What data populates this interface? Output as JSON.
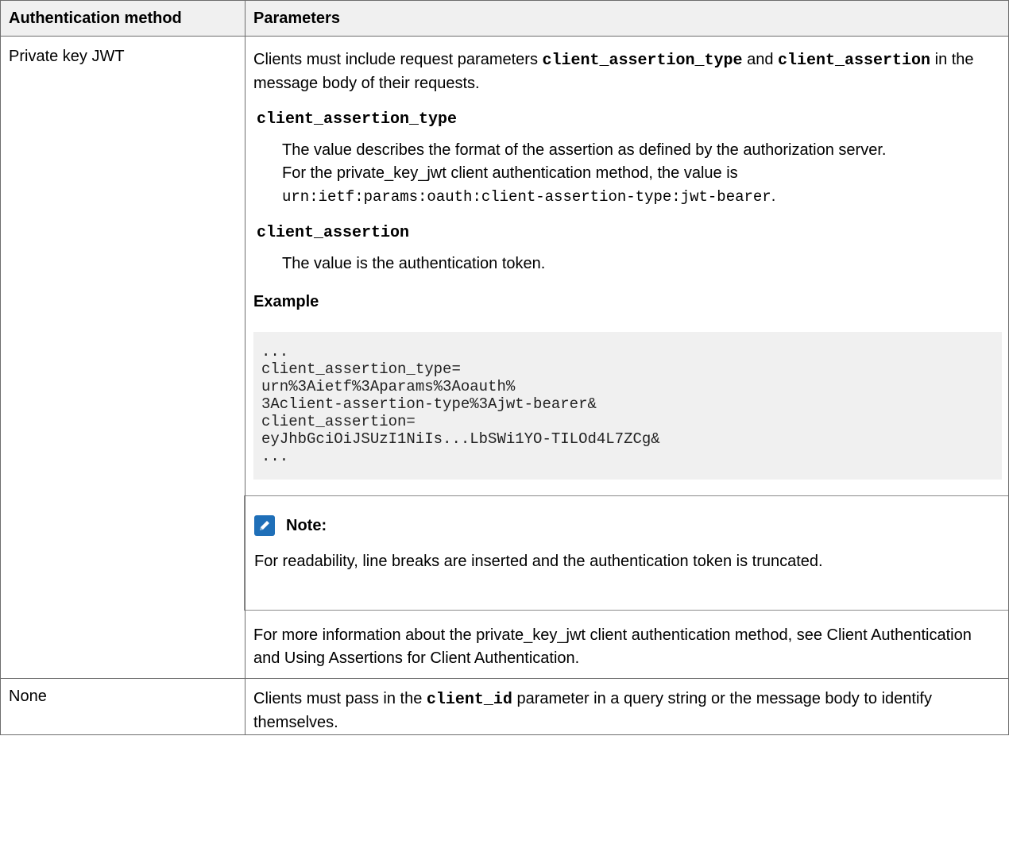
{
  "table": {
    "header": {
      "col1": "Authentication method",
      "col2": "Parameters"
    },
    "row1": {
      "method": "Private key JWT",
      "intro_pre": "Clients must include request parameters ",
      "intro_code1": "client_assertion_type",
      "intro_mid": " and ",
      "intro_code2": "client_assertion",
      "intro_post": " in the message body of their requests.",
      "term1": "client_assertion_type",
      "def1_text": "The value describes the format of the assertion as defined by the authorization server. For the private_key_jwt client authentication method, the value is ",
      "def1_code": "urn:ietf:params:oauth:client-assertion-type:jwt-bearer",
      "def1_end": ".",
      "term2": "client_assertion",
      "def2_text": "The value is the authentication token.",
      "example_title": "Example",
      "code": "...\nclient_assertion_type=\nurn%3Aietf%3Aparams%3Aoauth%\n3Aclient-assertion-type%3Ajwt-bearer&\nclient_assertion=\neyJhbGciOiJSUzI1NiIs...LbSWi1YO-TILOd4L7ZCg&\n...",
      "note_title": "Note:",
      "note_text": "For readability, line breaks are inserted and the authentication token is truncated.",
      "more_info": "For more information about the private_key_jwt client authentication method, see Client Authentication and Using Assertions for Client Authentication."
    },
    "row2": {
      "method": "None",
      "text_pre": "Clients must pass in the ",
      "text_code": "client_id",
      "text_post": " parameter in a query string or the message body to identify themselves."
    }
  },
  "icons": {
    "note_icon": "pencil-note-icon",
    "note_icon_color": "#1f6fb8"
  }
}
